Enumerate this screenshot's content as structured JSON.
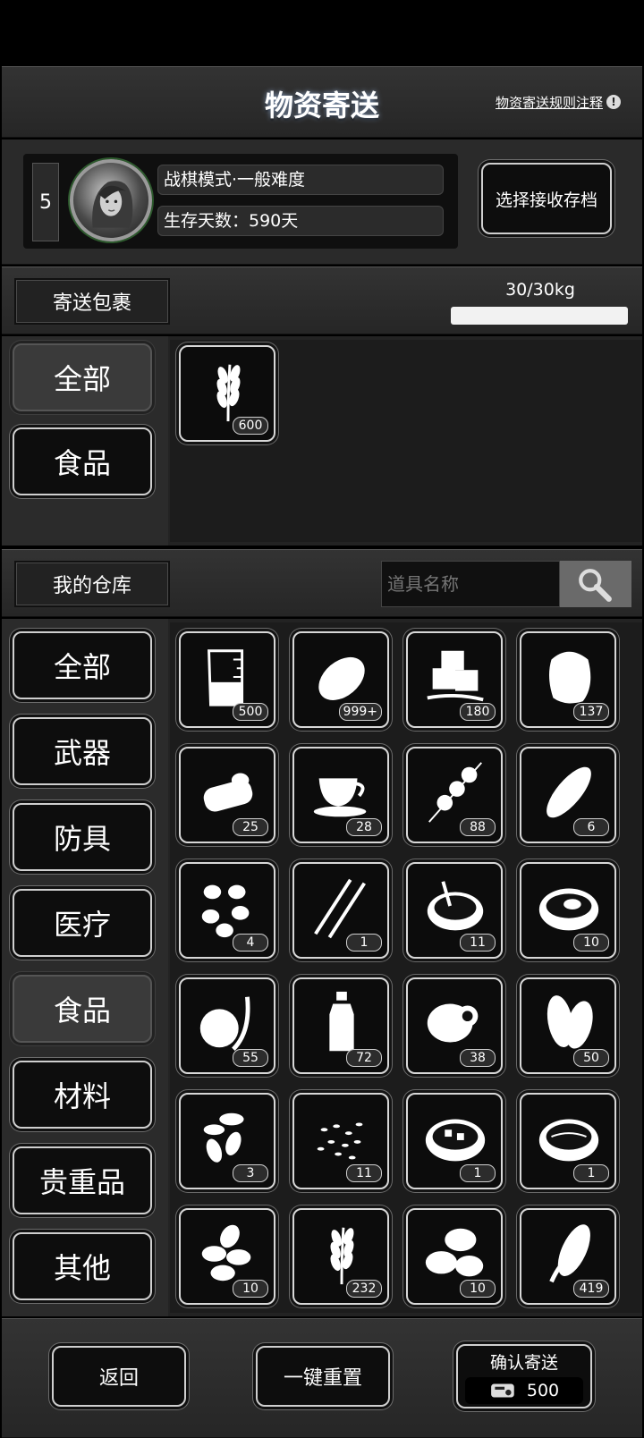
{
  "header": {
    "title": "物资寄送",
    "rules_link": "物资寄送规则注释"
  },
  "profile": {
    "slot_number": "5",
    "mode": "战棋模式·一般难度",
    "survival_days": "生存天数：590天",
    "select_save_button": "选择接收存档"
  },
  "package": {
    "label": "寄送包裹",
    "weight": "30/30kg",
    "weight_fill": 1.0,
    "categories": [
      {
        "label": "全部",
        "active": true
      },
      {
        "label": "食品",
        "active": false
      }
    ],
    "items": [
      {
        "icon": "wheat-icon",
        "count": "600"
      }
    ]
  },
  "warehouse": {
    "label": "我的仓库",
    "search_placeholder": "道具名称",
    "categories": [
      {
        "label": "全部",
        "active": false
      },
      {
        "label": "武器",
        "active": false
      },
      {
        "label": "防具",
        "active": false
      },
      {
        "label": "医疗",
        "active": false
      },
      {
        "label": "食品",
        "active": true
      },
      {
        "label": "材料",
        "active": false
      },
      {
        "label": "贵重品",
        "active": false
      },
      {
        "label": "其他",
        "active": false
      }
    ],
    "items": [
      {
        "icon": "beaker-icon",
        "count": "500"
      },
      {
        "icon": "potato-icon",
        "count": "999+"
      },
      {
        "icon": "sugar-cubes-icon",
        "count": "180"
      },
      {
        "icon": "meat-icon",
        "count": "137"
      },
      {
        "icon": "canned-food-icon",
        "count": "25"
      },
      {
        "icon": "coffee-cup-icon",
        "count": "28"
      },
      {
        "icon": "skewer-icon",
        "count": "88"
      },
      {
        "icon": "bread-icon",
        "count": "6"
      },
      {
        "icon": "nuts-icon",
        "count": "4"
      },
      {
        "icon": "grilled-skewers-icon",
        "count": "1"
      },
      {
        "icon": "soup-bowl-icon",
        "count": "11"
      },
      {
        "icon": "stew-pot-icon",
        "count": "10"
      },
      {
        "icon": "apple-sprout-icon",
        "count": "55"
      },
      {
        "icon": "water-bottle-icon",
        "count": "72"
      },
      {
        "icon": "egg-icon",
        "count": "38"
      },
      {
        "icon": "peanut-icon",
        "count": "50"
      },
      {
        "icon": "seeds-icon",
        "count": "3"
      },
      {
        "icon": "rice-icon",
        "count": "11"
      },
      {
        "icon": "hotpot-icon",
        "count": "1"
      },
      {
        "icon": "broth-bowl-icon",
        "count": "1"
      },
      {
        "icon": "almonds-icon",
        "count": "10"
      },
      {
        "icon": "wheat-icon",
        "count": "232"
      },
      {
        "icon": "coffee-beans-icon",
        "count": "10"
      },
      {
        "icon": "corn-icon",
        "count": "419"
      }
    ]
  },
  "footer": {
    "back_button": "返回",
    "reset_button": "一键重置",
    "confirm_button": "确认寄送",
    "cost": "500",
    "cost_icon": "ticket-icon"
  }
}
